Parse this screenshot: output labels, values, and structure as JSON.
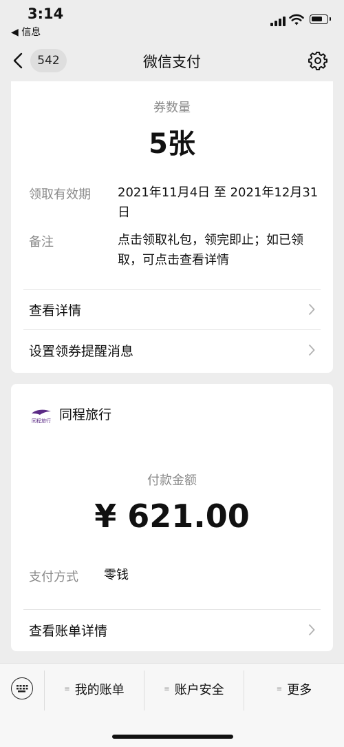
{
  "status_bar": {
    "time": "3:14",
    "back_app": "◀ 信息"
  },
  "nav": {
    "unread_count": "542",
    "title": "微信支付"
  },
  "coupon_card": {
    "count_label": "券数量",
    "count_value": "5张",
    "validity_label": "领取有效期",
    "validity_value": "2021年11月4日 至 2021年12月31日",
    "note_label": "备注",
    "note_value": "点击领取礼包，领完即止；如已领取，可点击查看详情",
    "links": [
      {
        "label": "查看详情"
      },
      {
        "label": "设置领券提醒消息"
      }
    ]
  },
  "payment_card": {
    "merchant_name": "同程旅行",
    "merchant_logo_text": "同程旅行",
    "amount_label": "付款金额",
    "amount_value": "¥ 621.00",
    "method_label": "支付方式",
    "method_value": "零钱",
    "bill_link": "查看账单详情"
  },
  "toolbar": {
    "items": [
      {
        "label": "我的账单"
      },
      {
        "label": "账户安全"
      },
      {
        "label": "更多"
      }
    ]
  },
  "colors": {
    "background": "#ededed",
    "card": "#ffffff",
    "secondary_text": "#8a8a8a",
    "logo_purple": "#5b2a86"
  }
}
